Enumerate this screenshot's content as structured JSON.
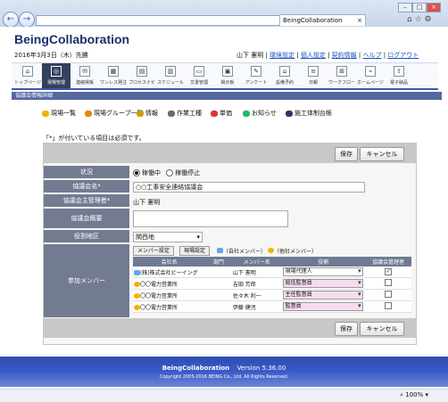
{
  "browser": {
    "tab_title": "BeingCollaboration",
    "address": "",
    "zoom": "100%"
  },
  "app": {
    "brand": "BeingCollaboration",
    "date": "2016年3月3日（木）先勝",
    "user_name": "山下 憲明",
    "links": [
      "環境設定",
      "個人設定",
      "契約情報",
      "ヘルプ",
      "ログアウト"
    ]
  },
  "toolbar": [
    {
      "label": "トップページ",
      "icon": "home-icon"
    },
    {
      "label": "現場管理",
      "icon": "site-icon"
    },
    {
      "label": "連絡掲板",
      "icon": "board-icon"
    },
    {
      "label": "ワンレス発注",
      "icon": "order-icon"
    },
    {
      "label": "プロセスナビ",
      "icon": "process-icon"
    },
    {
      "label": "スケジュール",
      "icon": "calendar-icon"
    },
    {
      "label": "文書管理",
      "icon": "folder-icon"
    },
    {
      "label": "掲示板",
      "icon": "notice-icon"
    },
    {
      "label": "アンケート",
      "icon": "survey-icon"
    },
    {
      "label": "設備予約",
      "icon": "reserve-icon"
    },
    {
      "label": "日報",
      "icon": "report-icon"
    },
    {
      "label": "ワークフロー",
      "icon": "workflow-icon"
    },
    {
      "label": "ホームページ",
      "icon": "web-icon"
    },
    {
      "label": "電子納品",
      "icon": "delivery-icon"
    }
  ],
  "section_title": "協議会情報詳細",
  "subnav": [
    {
      "label": "現場一覧",
      "color": "#f1b300"
    },
    {
      "label": "現場グループ一覧",
      "color": "#e08a00"
    },
    {
      "label": "情報",
      "color": "#c8a000"
    },
    {
      "label": "作業工種",
      "color": "#6a6a6a"
    },
    {
      "label": "単価",
      "color": "#d32"
    },
    {
      "label": "お知らせ",
      "color": "#2b6"
    },
    {
      "label": "施工体制台帳",
      "color": "#336"
    }
  ],
  "required_note": "「*」が付いている項目は必須です。",
  "buttons": {
    "save": "保存",
    "cancel": "キャンセル"
  },
  "form": {
    "status_label": "状況",
    "status_options": [
      "稼働中",
      "稼働停止"
    ],
    "status_selected": "稼働中",
    "council_name_label": "協議会名*",
    "council_name_value": "○○工事安全連絡協議会",
    "manager_label": "協議会主管理者*",
    "manager_value": "山下 憲明",
    "summary_label": "協議会概要",
    "summary_value": "",
    "region_label": "役割地区",
    "region_value": "関西地",
    "members_label": "参加メンバー"
  },
  "members": {
    "tab_member_setting": "メンバー設定",
    "tab_site_setting": "現場設定",
    "legend_own": "（自社メンバー）",
    "legend_other": "（他社メンバー）",
    "columns": [
      "会社名",
      "部門",
      "メンバー名",
      "役割",
      "協議会管理者"
    ],
    "rows": [
      {
        "company": "(株)株式会社ビーイング",
        "dept": "",
        "name": "山下 憲明",
        "role": "現場代理人",
        "admin": true,
        "own": true
      },
      {
        "company": "〇〇電力営業所",
        "dept": "",
        "name": "吉田 芳郎",
        "role": "総括監督員",
        "admin": false,
        "own": false
      },
      {
        "company": "〇〇電力営業所",
        "dept": "",
        "name": "佐々木 利一",
        "role": "主任監督員",
        "admin": false,
        "own": false
      },
      {
        "company": "〇〇電力営業所",
        "dept": "",
        "name": "伊藤 健児",
        "role": "監督員",
        "admin": false,
        "own": false
      }
    ]
  },
  "footer": {
    "product": "BeingCollaboration",
    "version": "Version 5.36.00",
    "copyright": "Copyright 2005-2016 BEING Co., Ltd. All Rights Reserved."
  }
}
